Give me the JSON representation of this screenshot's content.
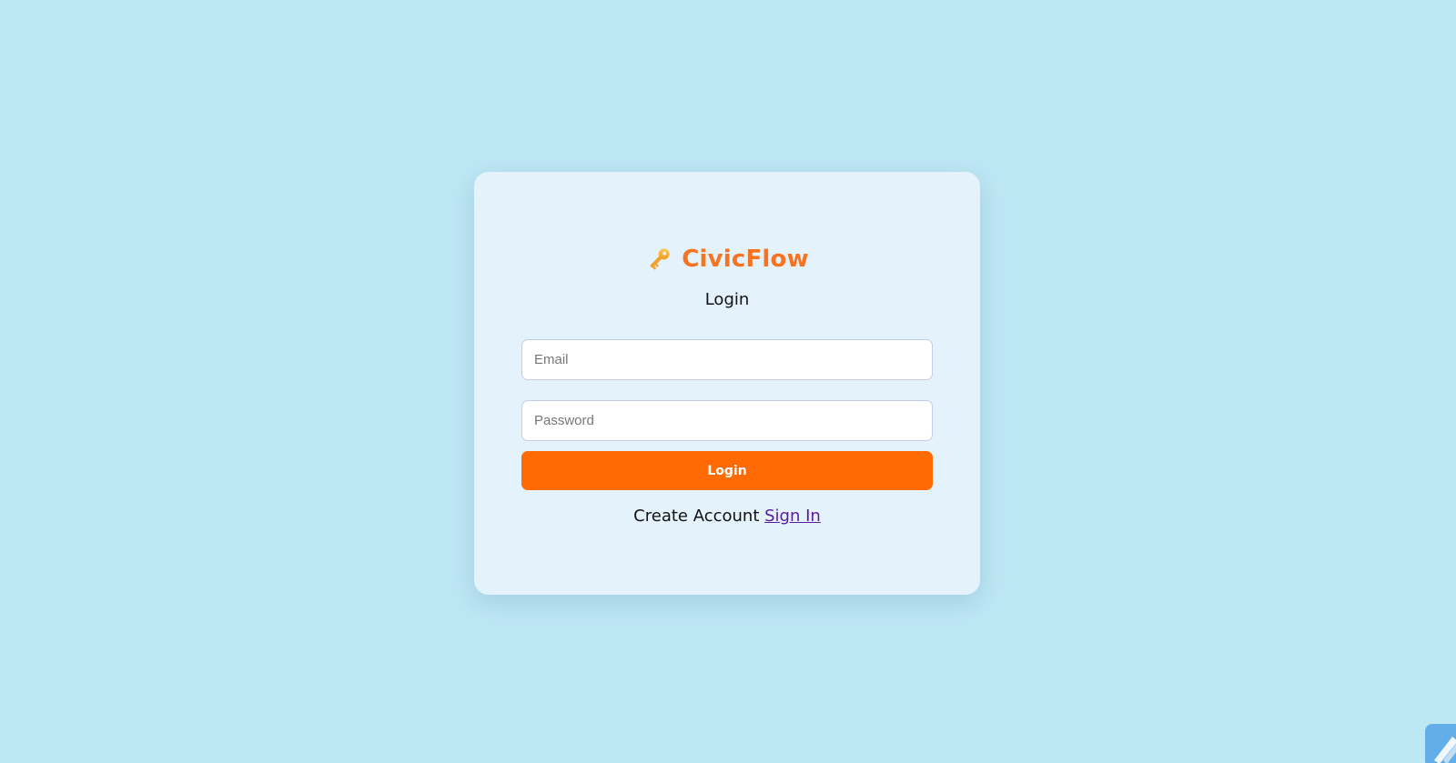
{
  "brand": {
    "icon": "key-icon",
    "name": "CivicFlow",
    "color": "#f7731f"
  },
  "form": {
    "title": "Login",
    "email_placeholder": "Email",
    "password_placeholder": "Password",
    "submit_label": "Login",
    "footer_text": "Create Account",
    "footer_link": "Sign In"
  },
  "colors": {
    "background": "#bee7f4",
    "card": "#e4f2fc",
    "button": "#ff6a05",
    "link": "#5b1a9e"
  },
  "corner_widget": {
    "icon": "edit-pencil-icon"
  }
}
